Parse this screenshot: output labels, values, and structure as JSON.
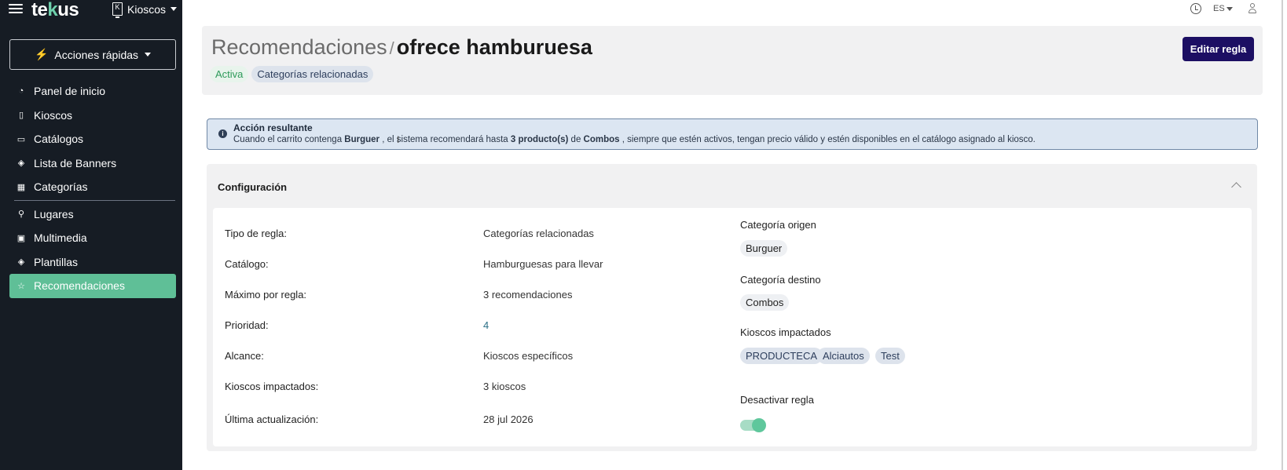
{
  "app": {
    "logo_prefix": "te",
    "logo_accent": "k",
    "logo_suffix": "us",
    "kiosk_switch_label": "Kioscos",
    "kiosk_icon_glyph": "K"
  },
  "sidebar": {
    "quick_actions_label": "Acciones rápidas",
    "items": [
      {
        "label": "Panel de inicio",
        "icon": "dashboard-icon"
      },
      {
        "label": "Kioscos",
        "icon": "kiosk-icon"
      },
      {
        "label": "Catálogos",
        "icon": "book-icon"
      },
      {
        "label": "Lista de Banners",
        "icon": "layers-icon"
      },
      {
        "label": "Categorías",
        "icon": "boxes-icon"
      },
      {
        "label": "Lugares",
        "icon": "location-pin-icon"
      },
      {
        "label": "Multimedia",
        "icon": "image-icon"
      },
      {
        "label": "Plantillas",
        "icon": "layers-icon"
      },
      {
        "label": "Recomendaciones",
        "icon": "star-icon"
      }
    ]
  },
  "topbar": {
    "language": "ES"
  },
  "header": {
    "breadcrumb": "Recomendaciones",
    "separator": "/",
    "title": "ofrece hamburuesa",
    "status_badge": "Activa",
    "type_badge": "Categorías relacionadas",
    "edit_button": "Editar regla"
  },
  "alert": {
    "title": "Acción resultante",
    "text_1": "Cuando el carrito contenga ",
    "source_category": "Burguer",
    "text_2": " , el sistema recomendará hasta ",
    "quantity": "3 producto(s)",
    "text_3": " de ",
    "target_category": "Combos",
    "text_4": " , siempre que estén activos, tengan precio válido y estén disponibles en el catálogo asignado al kiosco."
  },
  "config": {
    "title": "Configuración",
    "rows": [
      {
        "label": "Tipo de regla:",
        "value": "Categorías relacionadas"
      },
      {
        "label": "Catálogo:",
        "value": "Hamburguesas para llevar"
      },
      {
        "label": "Máximo por regla:",
        "value": "3 recomendaciones"
      },
      {
        "label": "Prioridad:",
        "value": "4"
      },
      {
        "label": "Alcance:",
        "value": "Kioscos específicos"
      },
      {
        "label": "Kioscos impactados:",
        "value": "3 kioscos"
      },
      {
        "label": "Última actualización:",
        "value": "28 jul 2026"
      }
    ],
    "source_category_label": "Categoría origen",
    "source_category_chip": "Burguer",
    "target_category_label": "Categoría destino",
    "target_category_chip": "Combos",
    "impacted_kiosks_label": "Kioscos impactados",
    "impacted_kiosks": [
      "PRODUCTECA",
      "Alciautos",
      "Test"
    ],
    "deactivate_label": "Desactivar regla",
    "deactivate_on": true
  }
}
